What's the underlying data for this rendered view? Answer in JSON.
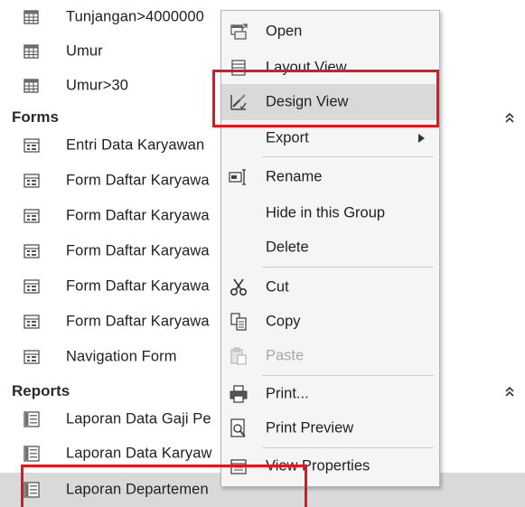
{
  "navigation_pane": {
    "queries_partial": [
      {
        "label": "Tunjangan>4000000",
        "icon": "query-icon"
      },
      {
        "label": "Umur",
        "icon": "query-icon"
      },
      {
        "label": "Umur>30",
        "icon": "query-icon"
      }
    ],
    "forms_group": {
      "label": "Forms",
      "collapse_icon": "chevron-double-up-icon",
      "items": [
        {
          "label": "Entri Data Karyawan",
          "icon": "form-icon"
        },
        {
          "label": "Form Daftar Karyawa",
          "icon": "form-icon"
        },
        {
          "label": "Form Daftar Karyawa",
          "icon": "form-icon"
        },
        {
          "label": "Form Daftar Karyawa",
          "icon": "form-icon"
        },
        {
          "label": "Form Daftar Karyawa",
          "icon": "form-icon"
        },
        {
          "label": "Form Daftar Karyawa",
          "icon": "form-icon"
        },
        {
          "label": "Navigation Form",
          "icon": "form-icon"
        }
      ]
    },
    "reports_group": {
      "label": "Reports",
      "collapse_icon": "chevron-double-up-icon",
      "items": [
        {
          "label": "Laporan Data Gaji Pe",
          "icon": "report-icon"
        },
        {
          "label": "Laporan Data Karyaw",
          "icon": "report-icon"
        },
        {
          "label": "Laporan Departemen",
          "icon": "report-icon",
          "selected": true
        }
      ]
    }
  },
  "context_menu": {
    "items": [
      {
        "label": "Open",
        "icon": "open-icon"
      },
      {
        "label": "Layout View",
        "icon": "layout-view-icon"
      },
      {
        "label": "Design View",
        "icon": "design-view-icon",
        "hover": true
      },
      {
        "label": "Export",
        "icon": "",
        "submenu": true
      },
      {
        "label": "Rename",
        "icon": "rename-icon"
      },
      {
        "label": "Hide in this Group",
        "icon": ""
      },
      {
        "label": "Delete",
        "icon": ""
      },
      {
        "label": "Cut",
        "icon": "scissors-icon"
      },
      {
        "label": "Copy",
        "icon": "copy-icon"
      },
      {
        "label": "Paste",
        "icon": "paste-icon",
        "disabled": true
      },
      {
        "label": "Print...",
        "icon": "printer-icon"
      },
      {
        "label": "Print Preview",
        "icon": "print-preview-icon"
      },
      {
        "label": "View Properties",
        "icon": "properties-icon"
      }
    ]
  },
  "colors": {
    "highlight_box": "#e8141c",
    "selected_row": "#d9d9d9",
    "menu_background": "#f5f5f5",
    "disabled_text": "#a8a8a8"
  }
}
